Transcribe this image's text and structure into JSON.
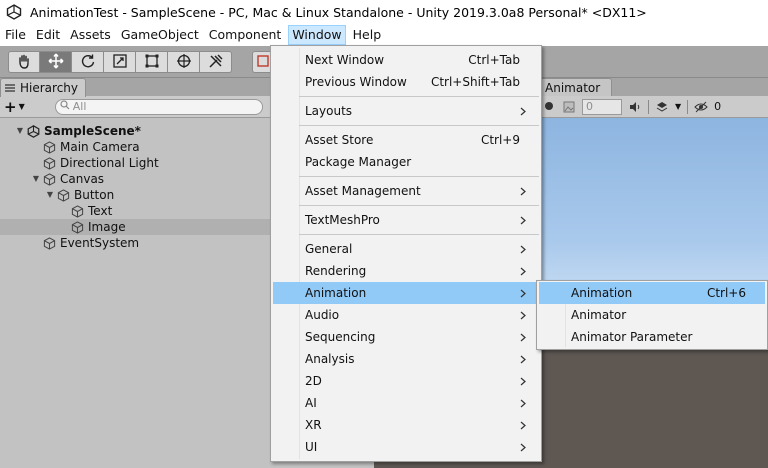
{
  "title_bar": {
    "title": "AnimationTest - SampleScene - PC, Mac & Linux Standalone - Unity 2019.3.0a8 Personal* <DX11>"
  },
  "menu_bar": {
    "items": [
      "File",
      "Edit",
      "Assets",
      "GameObject",
      "Component",
      "Window",
      "Help"
    ],
    "active": "Window"
  },
  "toolbar": {
    "tools": [
      "hand-tool-icon",
      "move-tool-icon",
      "rotate-tool-icon",
      "scale-tool-icon",
      "rect-tool-icon",
      "transform-tool-icon",
      "custom-tool-icon"
    ],
    "selected_tool": "move-tool-icon"
  },
  "hierarchy": {
    "tab_label": "Hierarchy",
    "search_placeholder": "All",
    "scene_name": "SampleScene*",
    "items": [
      {
        "name": "Main Camera",
        "depth": 1
      },
      {
        "name": "Directional Light",
        "depth": 1
      },
      {
        "name": "Canvas",
        "depth": 1,
        "expanded": true
      },
      {
        "name": "Button",
        "depth": 2,
        "expanded": true
      },
      {
        "name": "Text",
        "depth": 3
      },
      {
        "name": "Image",
        "depth": 3,
        "selected": true
      },
      {
        "name": "EventSystem",
        "depth": 1
      }
    ]
  },
  "scene_panel": {
    "tab_label": "Animator",
    "field_value": "0",
    "hidden_count": "0"
  },
  "window_menu": {
    "items": [
      {
        "label": "Next Window",
        "shortcut": "Ctrl+Tab"
      },
      {
        "label": "Previous Window",
        "shortcut": "Ctrl+Shift+Tab"
      },
      {
        "label": "Layouts",
        "submenu": true
      },
      {
        "label": "Asset Store",
        "shortcut": "Ctrl+9"
      },
      {
        "label": "Package Manager"
      },
      {
        "label": "Asset Management",
        "submenu": true
      },
      {
        "label": "TextMeshPro",
        "submenu": true
      },
      {
        "label": "General",
        "submenu": true
      },
      {
        "label": "Rendering",
        "submenu": true
      },
      {
        "label": "Animation",
        "submenu": true,
        "highlighted": true
      },
      {
        "label": "Audio",
        "submenu": true
      },
      {
        "label": "Sequencing",
        "submenu": true
      },
      {
        "label": "Analysis",
        "submenu": true
      },
      {
        "label": "2D",
        "submenu": true
      },
      {
        "label": "AI",
        "submenu": true
      },
      {
        "label": "XR",
        "submenu": true
      },
      {
        "label": "UI",
        "submenu": true
      }
    ]
  },
  "animation_submenu": {
    "items": [
      {
        "label": "Animation",
        "shortcut": "Ctrl+6",
        "highlighted": true
      },
      {
        "label": "Animator"
      },
      {
        "label": "Animator Parameter"
      }
    ]
  },
  "colors": {
    "menu_highlight": "#91c9f7",
    "menubar_active": "#cce8ff",
    "panel_bg": "#c2c2c2",
    "toolbar_bg": "#a5a5a5"
  }
}
